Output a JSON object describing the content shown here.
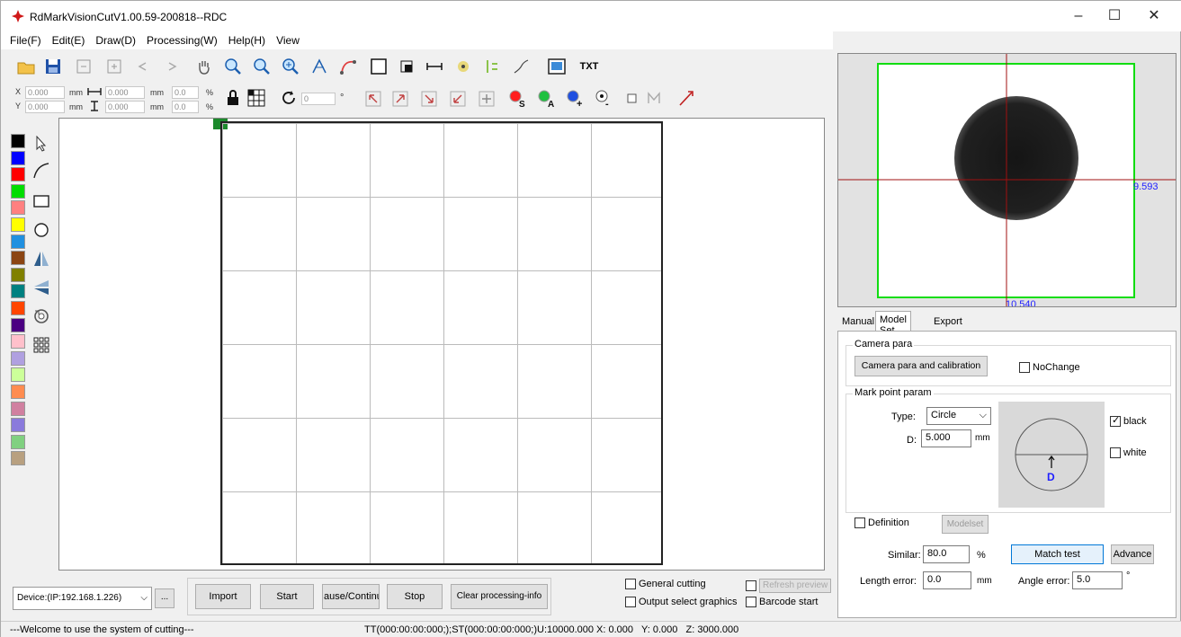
{
  "window": {
    "title": "RdMarkVisionCutV1.00.59-200818--RDC"
  },
  "menu": [
    "File(F)",
    "Edit(E)",
    "Draw(D)",
    "Processing(W)",
    "Help(H)",
    "View"
  ],
  "toolbar": {
    "txt_label": "TXT"
  },
  "coords": {
    "x_label": "X",
    "y_label": "Y",
    "x_value": "0.000",
    "y_value": "0.000",
    "w_value": "0.000",
    "h_value": "0.000",
    "sx_value": "0.0",
    "sy_value": "0.0",
    "unit_mm": "mm",
    "unit_pct": "%",
    "rotate_value": "0",
    "degree": "°"
  },
  "palette_colors": [
    "#000000",
    "#0000ff",
    "#ff0000",
    "#00dd00",
    "#ff8080",
    "#ffff00",
    "#2090e0",
    "#8b4513",
    "#808000",
    "#008080",
    "#ff4500",
    "#4b0082",
    "#ffc0cb",
    "#b0a0e0",
    "#ccff99",
    "#ff8c50",
    "#d080a0",
    "#8a7adc",
    "#80d080",
    "#b8a080"
  ],
  "bottom": {
    "device": "Device:(IP:192.168.1.226)",
    "more": "...",
    "buttons": [
      "Import",
      "Start",
      "ause/Continu",
      "Stop",
      "Clear processing-info"
    ],
    "general_cutting": "General cutting",
    "output_select": "Output select graphics",
    "refresh_preview": "Refresh preview",
    "barcode_start": "Barcode start"
  },
  "status": {
    "welcome": "---Welcome to use the system of cutting---",
    "info": "TT(000:00:00:000;);ST(000:00:00:000;)U:10000.000 X: 0.000   Y: 0.000   Z: 3000.000"
  },
  "preview": {
    "right_value": "9.593",
    "bottom_value": "10.540"
  },
  "tabs": [
    "Manual",
    "Model Set",
    "Export"
  ],
  "camera": {
    "title": "Camera para",
    "button": "Camera para and calibration",
    "nochange": "NoChange"
  },
  "mark": {
    "title": "Mark point param",
    "type_label": "Type:",
    "type_value": "Circle",
    "d_label": "D:",
    "d_value": "5.000",
    "unit": "mm",
    "diagram_label": "D",
    "black": "black",
    "white": "white"
  },
  "definition": {
    "label": "Definition",
    "modelset": "Modelset",
    "similar_label": "Similar:",
    "similar_value": "80.0",
    "pct": "%",
    "match_test": "Match test",
    "advance": "Advance",
    "length_label": "Length error:",
    "length_value": "0.0",
    "length_unit": "mm",
    "angle_label": "Angle error:",
    "angle_value": "5.0",
    "angle_unit": "°"
  }
}
